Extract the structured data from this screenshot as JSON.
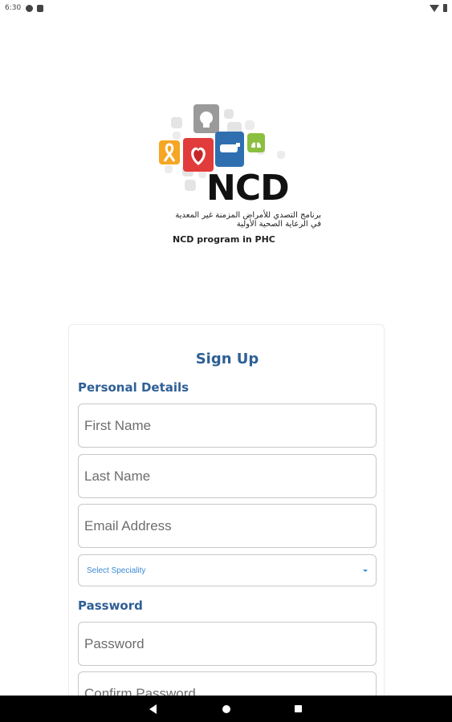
{
  "status_bar": {
    "time": "6:30"
  },
  "logo": {
    "title": "NCD",
    "arabic_line1": "برنامج التصدي للأمراض المزمنة غير المعدية",
    "arabic_line2": "في الرعاية الصحية الأولية",
    "english": "NCD program in PHC"
  },
  "form": {
    "title": "Sign Up",
    "personal_section": "Personal Details",
    "first_name_placeholder": "First Name",
    "last_name_placeholder": "Last Name",
    "email_placeholder": "Email Address",
    "speciality_select": "Select Speciality",
    "password_section": "Password",
    "password_placeholder": "Password",
    "confirm_password_placeholder": "Confirm Password"
  },
  "colors": {
    "primary": "#2f5f95",
    "select_text": "#3a8ad6",
    "tile_orange": "#f5a623",
    "tile_red": "#e23b3b",
    "tile_blue": "#2f6fb0",
    "tile_green": "#8bbf3f",
    "tile_gray": "#9a9a9a",
    "tile_light": "#e4e4e4"
  }
}
